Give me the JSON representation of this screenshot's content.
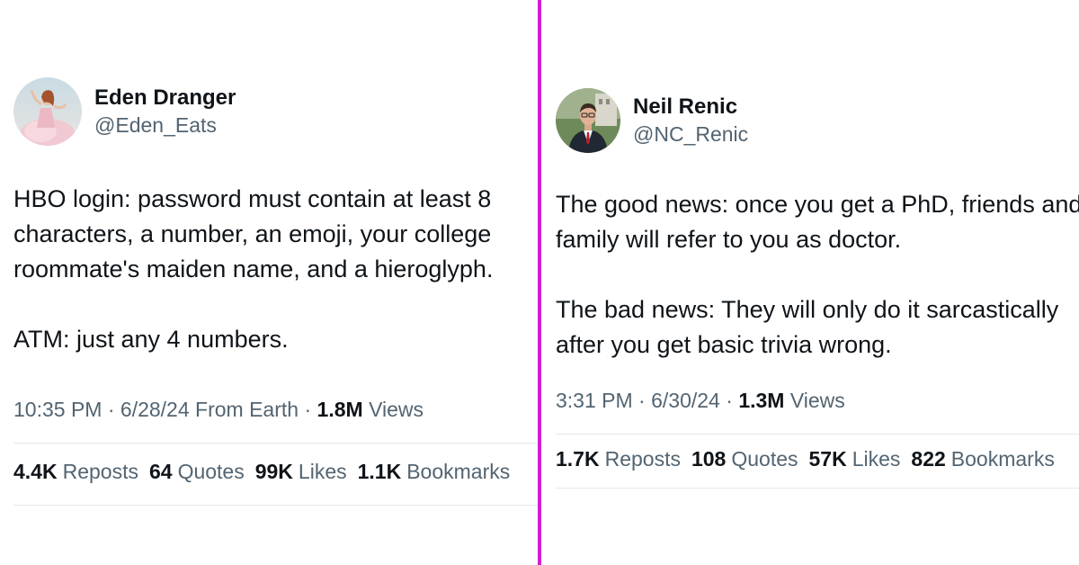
{
  "colors": {
    "divider": "#d21fd6",
    "secondary_text": "#536471",
    "primary_text": "#0f1419"
  },
  "tweets": [
    {
      "author": {
        "name": "Eden Dranger",
        "handle": "@Eden_Eats",
        "avatar": "woman-in-pink-dress-avatar"
      },
      "text": "HBO login: password must contain at least 8 characters, a number, an emoji, your college roommate's maiden name, and a hieroglyph.\n\nATM: just any 4 numbers.",
      "time": "10:35 PM",
      "date": "6/28/24",
      "source": "From Earth",
      "views_count": "1.8M",
      "views_label": "Views",
      "stats": [
        {
          "count": "4.4K",
          "label": "Reposts"
        },
        {
          "count": "64",
          "label": "Quotes"
        },
        {
          "count": "99K",
          "label": "Likes"
        },
        {
          "count": "1.1K",
          "label": "Bookmarks"
        }
      ]
    },
    {
      "author": {
        "name": "Neil Renic",
        "handle": "@NC_Renic",
        "avatar": "man-in-suit-avatar"
      },
      "text": "The good news: once you get a PhD, friends and family will refer to you as doctor.\n\nThe bad news: They will only do it sarcastically after you get basic trivia wrong.",
      "time": "3:31 PM",
      "date": "6/30/24",
      "views_count": "1.3M",
      "views_label": "Views",
      "stats": [
        {
          "count": "1.7K",
          "label": "Reposts"
        },
        {
          "count": "108",
          "label": "Quotes"
        },
        {
          "count": "57K",
          "label": "Likes"
        },
        {
          "count": "822",
          "label": "Bookmarks"
        }
      ]
    }
  ]
}
